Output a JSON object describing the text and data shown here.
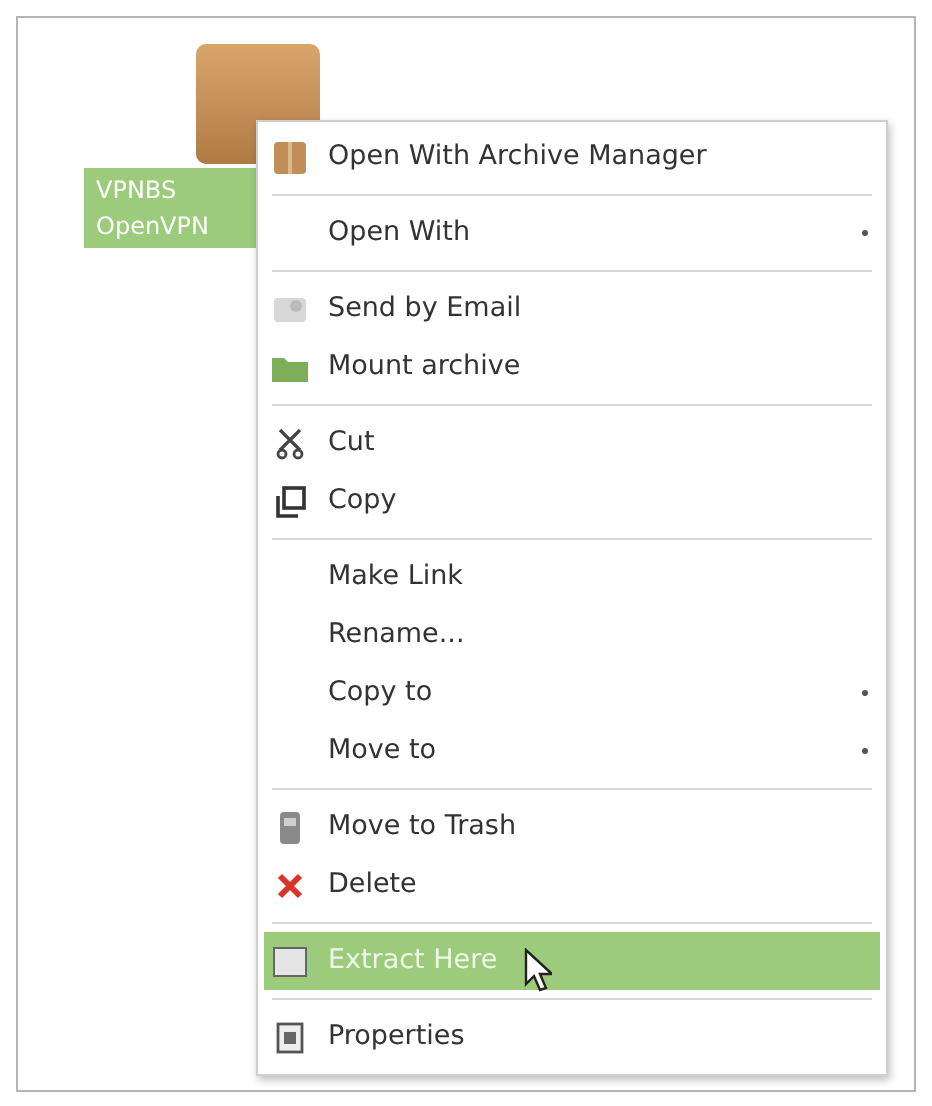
{
  "desktop_icon": {
    "label_lines": [
      "VPNBS",
      "OpenVPN"
    ],
    "selected": true
  },
  "context_menu": {
    "items": [
      {
        "kind": "item",
        "label": "Open With Archive Manager",
        "icon": true,
        "submenu": false,
        "selected": false
      },
      {
        "kind": "separator"
      },
      {
        "kind": "item",
        "label": "Open With",
        "icon": false,
        "submenu": true,
        "selected": false
      },
      {
        "kind": "separator"
      },
      {
        "kind": "item",
        "label": "Send by Email",
        "icon": true,
        "submenu": false,
        "selected": false
      },
      {
        "kind": "item",
        "label": "Mount archive",
        "icon": true,
        "submenu": false,
        "selected": false
      },
      {
        "kind": "separator"
      },
      {
        "kind": "item",
        "label": "Cut",
        "icon": true,
        "submenu": false,
        "selected": false
      },
      {
        "kind": "item",
        "label": "Copy",
        "icon": true,
        "submenu": false,
        "selected": false
      },
      {
        "kind": "separator"
      },
      {
        "kind": "item",
        "label": "Make Link",
        "icon": false,
        "submenu": false,
        "selected": false
      },
      {
        "kind": "item",
        "label": "Rename...",
        "icon": false,
        "submenu": false,
        "selected": false
      },
      {
        "kind": "item",
        "label": "Copy to",
        "icon": false,
        "submenu": true,
        "selected": false
      },
      {
        "kind": "item",
        "label": "Move to",
        "icon": false,
        "submenu": true,
        "selected": false
      },
      {
        "kind": "separator"
      },
      {
        "kind": "item",
        "label": "Move to Trash",
        "icon": true,
        "submenu": false,
        "selected": false
      },
      {
        "kind": "item",
        "label": "Delete",
        "icon": true,
        "submenu": false,
        "selected": false
      },
      {
        "kind": "separator"
      },
      {
        "kind": "item",
        "label": "Extract Here",
        "icon": true,
        "submenu": false,
        "selected": true
      },
      {
        "kind": "separator"
      },
      {
        "kind": "item",
        "label": "Properties",
        "icon": true,
        "submenu": false,
        "selected": false
      }
    ]
  }
}
